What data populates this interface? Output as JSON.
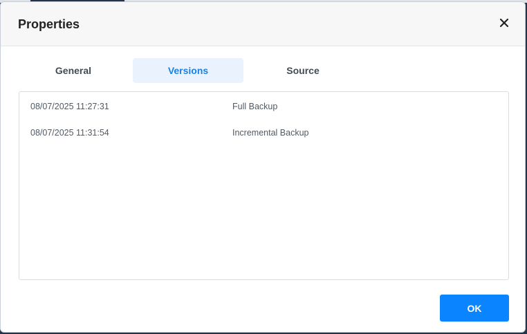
{
  "dialog": {
    "title": "Properties",
    "close_icon": "close-icon"
  },
  "tabs": [
    {
      "label": "General",
      "active": false
    },
    {
      "label": "Versions",
      "active": true
    },
    {
      "label": "Source",
      "active": false
    }
  ],
  "versions": [
    {
      "date": "08/07/2025 11:27:31",
      "type": "Full Backup"
    },
    {
      "date": "08/07/2025 11:31:54",
      "type": "Incremental Backup"
    }
  ],
  "footer": {
    "ok_label": "OK"
  },
  "colors": {
    "accent": "#0a84ff",
    "active_tab_bg": "#eaf3fd",
    "active_tab_text": "#1a82e2"
  }
}
